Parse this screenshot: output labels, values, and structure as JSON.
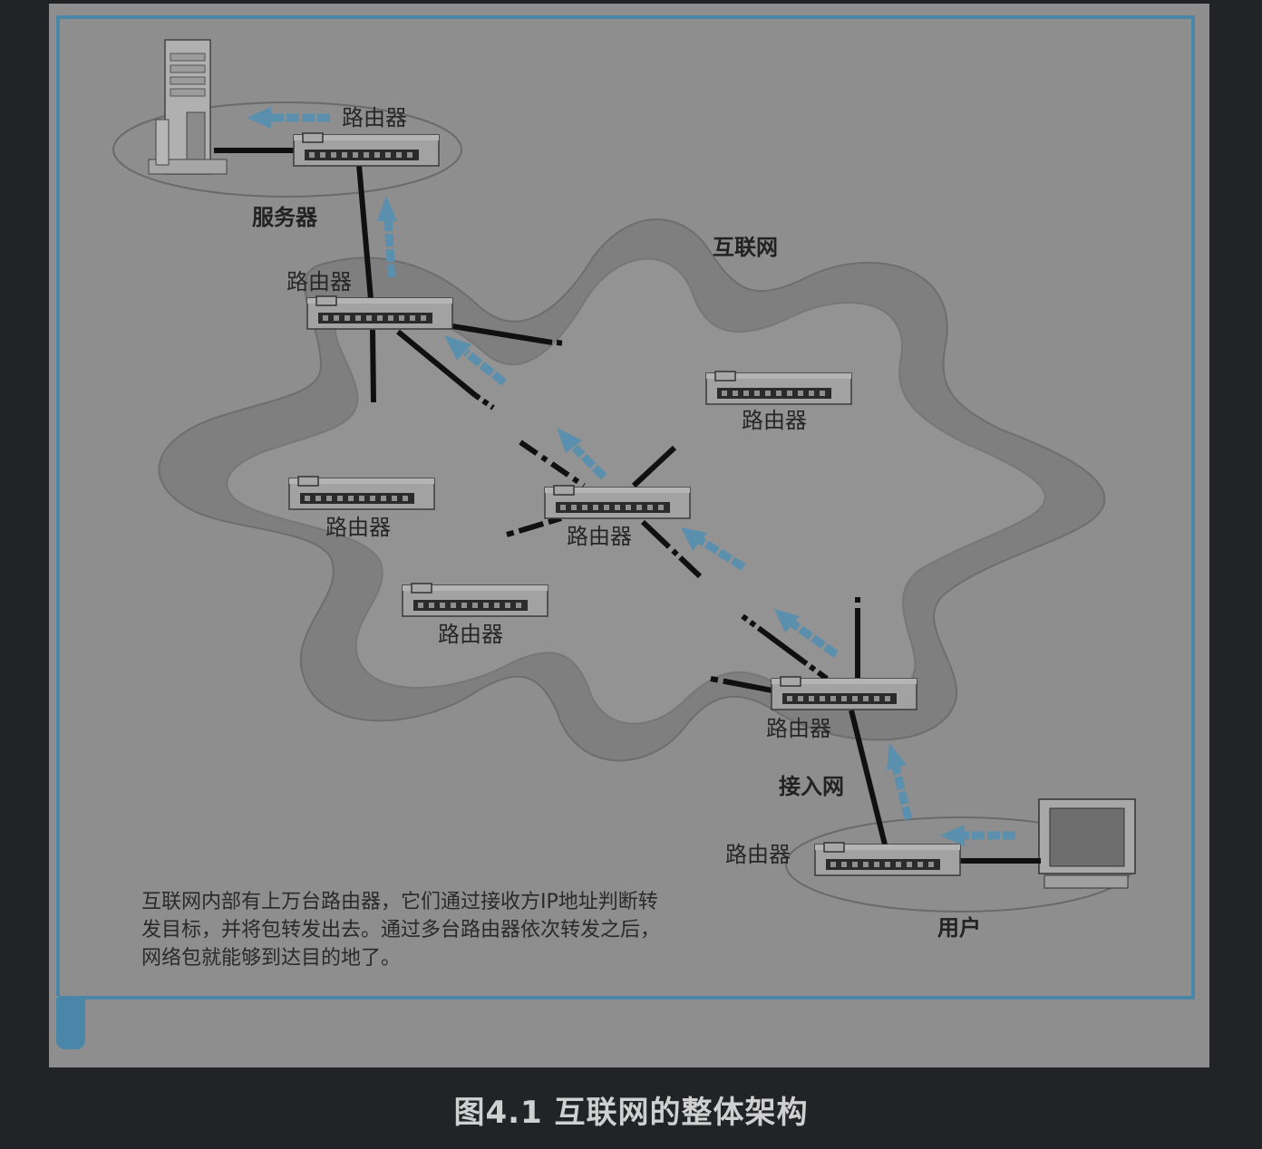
{
  "figure": {
    "caption": "图4.1 互联网的整体架构",
    "labels": {
      "server": "服务器",
      "internet": "互联网",
      "access_network": "接入网",
      "user": "用户"
    },
    "routers": [
      {
        "id": "server-router",
        "label": "路由器"
      },
      {
        "id": "edge-router-top",
        "label": "路由器"
      },
      {
        "id": "router-right",
        "label": "路由器"
      },
      {
        "id": "router-left",
        "label": "路由器"
      },
      {
        "id": "router-center",
        "label": "路由器"
      },
      {
        "id": "router-bottom-left",
        "label": "路由器"
      },
      {
        "id": "edge-router-bottom",
        "label": "路由器"
      },
      {
        "id": "user-router",
        "label": "路由器"
      }
    ],
    "description": [
      "互联网内部有上万台路由器，它们通过接收方IP地址判断转",
      "发目标，并将包转发出去。通过多台路由器依次转发之后，",
      "网络包就能够到达目的地了。"
    ],
    "colors": {
      "panel": "#8e8e8e",
      "border": "#4a86a8",
      "cloud_outer": "#7f7f7f",
      "cloud_inner": "#929292",
      "arrow": "#5b8fae",
      "link": "#101010"
    }
  }
}
